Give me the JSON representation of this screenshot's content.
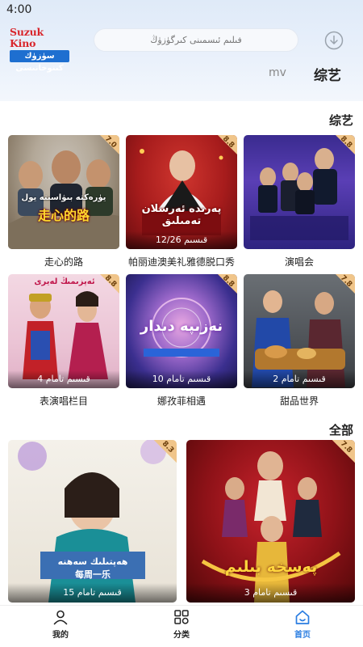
{
  "status_bar": {
    "time": "4:00"
  },
  "header": {
    "logo_top": "Suzuk Kino",
    "logo_bottom": "سۈزۈك كىنوخانىسى",
    "search_placeholder": "فىلىم ئىسمىنى كىرگۈزۈڭ",
    "icons": [
      "download-icon"
    ]
  },
  "tabs": [
    {
      "label": "mv",
      "active": false
    },
    {
      "label": "综艺",
      "active": true
    }
  ],
  "sections": {
    "variety_title": "综艺",
    "all_title": "全部"
  },
  "variety_items": [
    {
      "caption": "走心的路",
      "rating": "7.0",
      "episode": "",
      "overlay": "走心的路",
      "overlay_ug": "يۈرەكتە بىۋاسىتە يول"
    },
    {
      "caption": "帕丽迪澳美礼雅德脱口秀",
      "rating": "8.8",
      "episode": "12/26 قىسىم",
      "overlay": "پەرىدە ئەرسلان تەمىلىق",
      "overlay_ug": ""
    },
    {
      "caption": "演唱会",
      "rating": "8.8",
      "episode": "",
      "overlay": "",
      "overlay_ug": ""
    },
    {
      "caption": "表演唱栏目",
      "rating": "8.8",
      "episode": "4 قىسىم تامام",
      "overlay": "ئەپزىمىڭ لەيرى",
      "overlay_ug": ""
    },
    {
      "caption": "娜孜菲相遇",
      "rating": "8.8",
      "episode": "10 قىسىم تامام",
      "overlay": "نەزىپە دىدار",
      "overlay_ug": ""
    },
    {
      "caption": "甜品世界",
      "rating": "7.8",
      "episode": "2 قىسىم تامام",
      "overlay": "",
      "overlay_ug": ""
    }
  ],
  "all_items": [
    {
      "rating": "8.3",
      "episode": "15 قىسىم تامام",
      "overlay": "ھەپتىلىك سەھنە",
      "overlay_cn": "每周一乐"
    },
    {
      "rating": "7.8",
      "episode": "3 قىسىم تامام",
      "overlay": "پەسخە بىلىم",
      "overlay_cn": ""
    }
  ],
  "bottom_nav": [
    {
      "label": "我的",
      "icon": "user-icon",
      "active": false
    },
    {
      "label": "分类",
      "icon": "grid-icon",
      "active": false
    },
    {
      "label": "首页",
      "icon": "home-icon",
      "active": true
    }
  ],
  "colors": {
    "accent": "#2a7de1",
    "rating_badge": "#f0c58a",
    "header_bg": "#e4edf9"
  }
}
